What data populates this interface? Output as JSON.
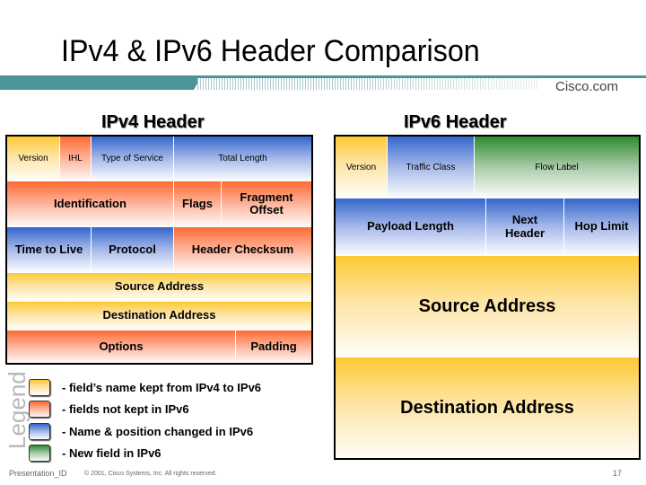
{
  "title": "IPv4 & IPv6 Header Comparison",
  "brand": "Cisco.com",
  "ipv4": {
    "title": "IPv4 Header",
    "fields": {
      "version": "Version",
      "ihl": "IHL",
      "tos": "Type of Service",
      "total_length": "Total Length",
      "identification": "Identification",
      "flags": "Flags",
      "fragment_offset": "Fragment Offset",
      "ttl": "Time to Live",
      "protocol": "Protocol",
      "checksum": "Header Checksum",
      "source": "Source Address",
      "destination": "Destination Address",
      "options": "Options",
      "padding": "Padding"
    }
  },
  "ipv6": {
    "title": "IPv6 Header",
    "fields": {
      "version": "Version",
      "traffic_class": "Traffic Class",
      "flow_label": "Flow Label",
      "payload_length": "Payload Length",
      "next_header": "Next Header",
      "hop_limit": "Hop Limit",
      "source": "Source Address",
      "destination": "Destination Address"
    }
  },
  "legend": {
    "title": "Legend",
    "items": [
      {
        "label": "- field’s name kept from IPv4 to IPv6",
        "color": "#fdc933"
      },
      {
        "label": "- fields not kept in IPv6",
        "color": "#fe6a33"
      },
      {
        "label": "- Name & position changed in IPv6",
        "color": "#3466cc"
      },
      {
        "label": "- New field in IPv6",
        "color": "#2f8a2f"
      }
    ]
  },
  "footer": {
    "presentation_id": "Presentation_ID",
    "copyright": "© 2001, Cisco Systems, Inc. All rights reserved.",
    "page": "17"
  }
}
